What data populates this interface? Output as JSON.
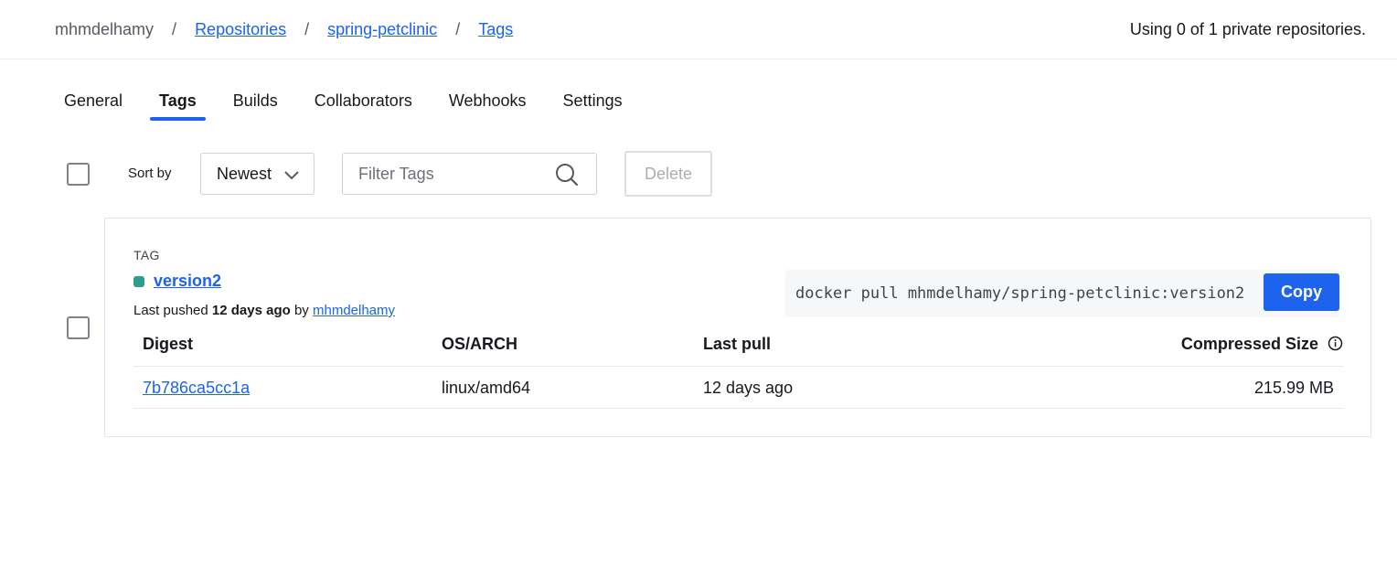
{
  "breadcrumb": {
    "owner": "mhmdelhamy",
    "separator": "/",
    "repositories": "Repositories",
    "repo": "spring-petclinic",
    "current": "Tags"
  },
  "usage_text": "Using 0 of 1 private repositories.",
  "tabs": [
    {
      "label": "General",
      "active": false
    },
    {
      "label": "Tags",
      "active": true
    },
    {
      "label": "Builds",
      "active": false
    },
    {
      "label": "Collaborators",
      "active": false
    },
    {
      "label": "Webhooks",
      "active": false
    },
    {
      "label": "Settings",
      "active": false
    }
  ],
  "toolbar": {
    "sort_label": "Sort by",
    "sort_value": "Newest",
    "filter_placeholder": "Filter Tags",
    "delete_label": "Delete"
  },
  "tag": {
    "header": "TAG",
    "name": "version2",
    "status_color": "#2e9e8a",
    "last_pushed_prefix": "Last pushed",
    "last_pushed_when": "12 days ago",
    "by": "by",
    "pushed_by": "mhmdelhamy",
    "pull_command": "docker pull mhmdelhamy/spring-petclinic:version2",
    "copy_label": "Copy"
  },
  "table": {
    "headers": {
      "digest": "Digest",
      "os_arch": "OS/ARCH",
      "last_pull": "Last pull",
      "compressed_size": "Compressed Size"
    },
    "rows": [
      {
        "digest": "7b786ca5cc1a",
        "os_arch": "linux/amd64",
        "last_pull": "12 days ago",
        "compressed_size": "215.99 MB"
      }
    ]
  },
  "colors": {
    "accent": "#1d63ed",
    "text": "#17191e"
  }
}
